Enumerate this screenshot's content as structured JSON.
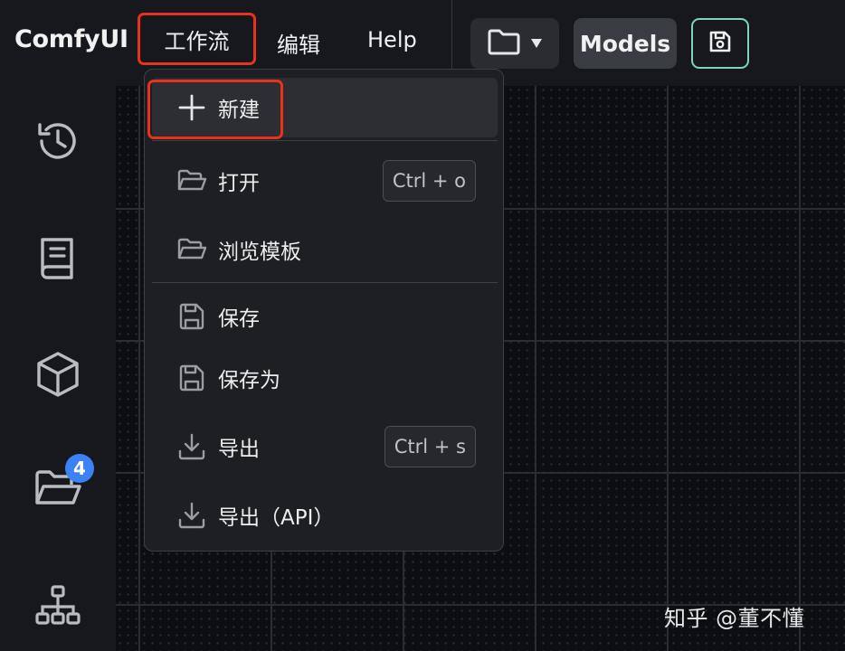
{
  "header": {
    "app_name": "ComfyUI",
    "menu": {
      "workflow": "工作流",
      "edit": "编辑",
      "help": "Help"
    },
    "models_label": "Models"
  },
  "sidebar": {
    "icons": [
      "history-icon",
      "book-icon",
      "cube-icon",
      "folder-open-icon",
      "node-tree-icon"
    ],
    "queue_badge": "4"
  },
  "workflow_menu": {
    "items": [
      {
        "label": "新建",
        "icon": "plus-icon",
        "shortcut": ""
      },
      {
        "label": "打开",
        "icon": "folder-open-icon",
        "shortcut": "Ctrl + o"
      },
      {
        "label": "浏览模板",
        "icon": "folder-open-icon",
        "shortcut": ""
      },
      {
        "label": "保存",
        "icon": "save-icon",
        "shortcut": ""
      },
      {
        "label": "保存为",
        "icon": "save-icon",
        "shortcut": ""
      },
      {
        "label": "导出",
        "icon": "download-icon",
        "shortcut": "Ctrl + s"
      },
      {
        "label": "导出（API）",
        "icon": "download-icon",
        "shortcut": ""
      }
    ]
  },
  "watermark": "知乎 @董不懂",
  "colors": {
    "highlight_border": "#e8321e",
    "accent": "#7fd3c1",
    "badge": "#3b82f6"
  }
}
